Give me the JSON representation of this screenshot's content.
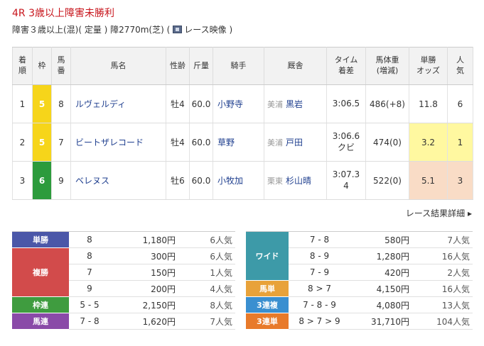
{
  "race": {
    "title": "4R 3歳以上障害未勝利",
    "sub_before": "障害３歳以上(混)( 定量 ) 障2770m(芝) (",
    "sub_video": "レース映像 )"
  },
  "table": {
    "headers": [
      "着\n順",
      "枠",
      "馬\n番",
      "馬名",
      "性齢",
      "斤量",
      "騎手",
      "厩舎",
      "タイム\n着差",
      "馬体重\n(増減)",
      "単勝\nオッズ",
      "人\n気"
    ],
    "rows": [
      {
        "rank": "1",
        "waku": "5",
        "num": "8",
        "name": "ルヴェルディ",
        "sexage": "牡4",
        "weight": "60.0",
        "jockey": "小野寺",
        "belong": "美浦",
        "trainer": "黒岩",
        "time": "3:06.5",
        "margin": "",
        "body": "486(+8)",
        "odds": "11.8",
        "pop": "6"
      },
      {
        "rank": "2",
        "waku": "5",
        "num": "7",
        "name": "ビートザレコード",
        "sexage": "牡4",
        "weight": "60.0",
        "jockey": "草野",
        "belong": "美浦",
        "trainer": "戸田",
        "time": "3:06.6",
        "margin": "クビ",
        "body": "474(0)",
        "odds": "3.2",
        "pop": "1"
      },
      {
        "rank": "3",
        "waku": "6",
        "num": "9",
        "name": "ベレヌス",
        "sexage": "牡6",
        "weight": "60.0",
        "jockey": "小牧加",
        "belong": "栗東",
        "trainer": "杉山晴",
        "time": "3:07.3",
        "margin": "4",
        "body": "522(0)",
        "odds": "5.1",
        "pop": "3"
      }
    ]
  },
  "detail_link": "レース結果詳細 ▸",
  "payout_left": {
    "tansho": {
      "label": "単勝",
      "color": "#4b57a8",
      "rows": [
        {
          "num": "8",
          "amt": "1,180円",
          "pop": "6人気"
        }
      ]
    },
    "fukusho": {
      "label": "複勝",
      "color": "#d24b4b",
      "rows": [
        {
          "num": "8",
          "amt": "300円",
          "pop": "6人気"
        },
        {
          "num": "7",
          "amt": "150円",
          "pop": "1人気"
        },
        {
          "num": "9",
          "amt": "200円",
          "pop": "4人気"
        }
      ]
    },
    "wakuren": {
      "label": "枠連",
      "color": "#3f9c3f",
      "rows": [
        {
          "num": "5 - 5",
          "amt": "2,150円",
          "pop": "8人気"
        }
      ]
    },
    "umaren": {
      "label": "馬連",
      "color": "#8a4aa8",
      "rows": [
        {
          "num": "7 - 8",
          "amt": "1,620円",
          "pop": "7人気"
        }
      ]
    }
  },
  "payout_right": {
    "wide": {
      "label": "ワイド",
      "color": "#3d9aa8",
      "rows": [
        {
          "num": "7 - 8",
          "amt": "580円",
          "pop": "7人気"
        },
        {
          "num": "8 - 9",
          "amt": "1,280円",
          "pop": "16人気"
        },
        {
          "num": "7 - 9",
          "amt": "420円",
          "pop": "2人気"
        }
      ]
    },
    "umatan": {
      "label": "馬単",
      "color": "#e8a23a",
      "rows": [
        {
          "num": "8 > 7",
          "amt": "4,150円",
          "pop": "16人気"
        }
      ]
    },
    "sanrenpuku": {
      "label": "3連複",
      "color": "#3a8fd0",
      "rows": [
        {
          "num": "7 - 8 - 9",
          "amt": "4,080円",
          "pop": "13人気"
        }
      ]
    },
    "sanrentan": {
      "label": "3連単",
      "color": "#e87a2a",
      "rows": [
        {
          "num": "8 > 7 > 9",
          "amt": "31,710円",
          "pop": "104人気"
        }
      ]
    }
  }
}
